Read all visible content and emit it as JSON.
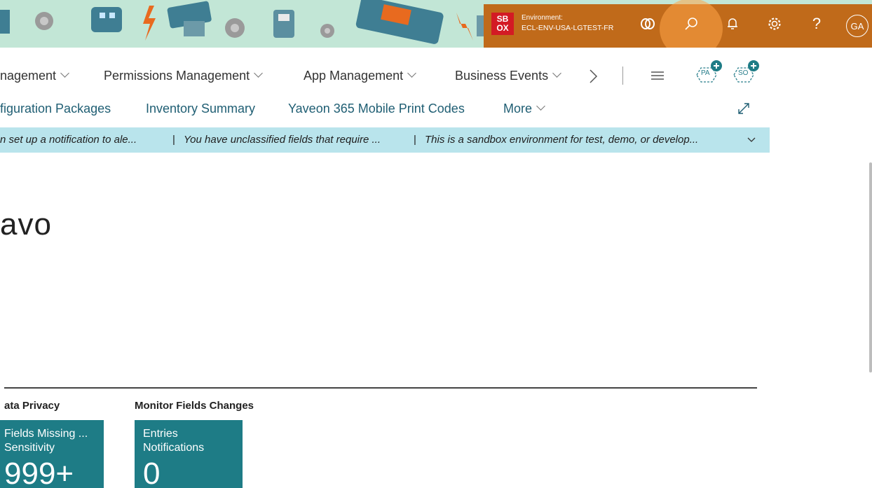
{
  "environment": {
    "badge_line1": "SB",
    "badge_line2": "OX",
    "label": "Environment:",
    "name": "ECL-ENV-USA-LGTEST-FR"
  },
  "topbar": {
    "avatar_initials": "GA",
    "help_glyph": "?"
  },
  "nav_primary": {
    "items": [
      "nagement",
      "Permissions Management",
      "App Management",
      "Business Events"
    ]
  },
  "nav_secondary": {
    "items": [
      "figuration Packages",
      "Inventory Summary",
      "Yaveon 365 Mobile Print Codes",
      "More"
    ]
  },
  "quick_create": {
    "pa": "PA",
    "so": "SO"
  },
  "notifications": [
    "n set up a notification to ale...",
    "You have unclassified fields that require ...",
    "This is a sandbox environment for test, demo, or develop..."
  ],
  "notifications_separator": "|",
  "headline": "avo",
  "groups": [
    {
      "title": "ata Privacy"
    },
    {
      "title": "Monitor Fields Changes"
    }
  ],
  "tiles": [
    {
      "line1": "Fields Missing ...",
      "line2": "Sensitivity",
      "value": "999+"
    },
    {
      "line1": "Entries",
      "line2": "Notifications",
      "value": "0"
    }
  ],
  "colors": {
    "accent_teal": "#1e7c86",
    "banner": "#b9e4ec",
    "env_bar": "#c06a1a",
    "sandbox_badge": "#d31a24",
    "search_highlight": "#ffa448"
  }
}
